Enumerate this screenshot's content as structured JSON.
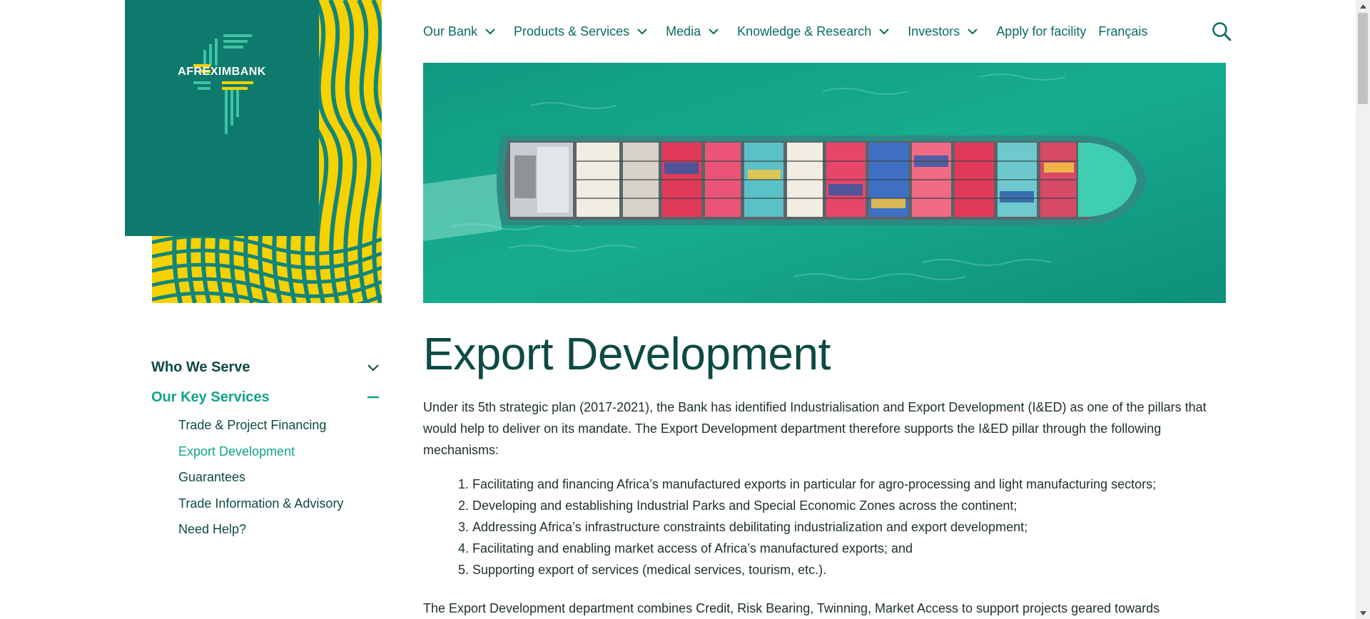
{
  "brand": {
    "name": "AFREXIMBANK"
  },
  "nav": {
    "items": [
      {
        "label": "Our Bank",
        "has_dropdown": true
      },
      {
        "label": "Products & Services",
        "has_dropdown": true
      },
      {
        "label": "Media",
        "has_dropdown": true
      },
      {
        "label": "Knowledge & Research",
        "has_dropdown": true
      },
      {
        "label": "Investors",
        "has_dropdown": true
      },
      {
        "label": "Apply for facility",
        "has_dropdown": false
      },
      {
        "label": "Français",
        "has_dropdown": false
      }
    ],
    "search_icon": "search-icon"
  },
  "sidebar": {
    "groups": [
      {
        "label": "Who We Serve",
        "state": "collapsed"
      },
      {
        "label": "Our Key Services",
        "state": "expanded"
      }
    ],
    "items": [
      {
        "label": "Trade & Project Financing",
        "active": false
      },
      {
        "label": "Export Development",
        "active": true
      },
      {
        "label": "Guarantees",
        "active": false
      },
      {
        "label": "Trade Information & Advisory",
        "active": false
      },
      {
        "label": "Need Help?",
        "active": false
      }
    ]
  },
  "main": {
    "title": "Export Development",
    "intro": "Under its 5th strategic plan (2017-2021), the Bank has identified Industrialisation and Export Development (I&ED) as one of the pillars that would help to deliver on its mandate. The Export Development department therefore supports the I&ED pillar through the following mechanisms:",
    "mechanisms": [
      "Facilitating and financing Africa’s manufactured exports in particular for agro-processing and light manufacturing sectors;",
      "Developing and establishing Industrial Parks and Special Economic Zones across the continent;",
      "Addressing Africa’s infrastructure constraints debilitating industrialization and export development;",
      "Facilitating and enabling market access of Africa’s manufactured exports; and",
      "Supporting export of services (medical services, tourism, etc.)."
    ],
    "after_text": "The Export Development department combines Credit, Risk Bearing, Twinning, Market Access to support projects geared towards promoting"
  },
  "colors": {
    "brand_teal": "#0d7a6d",
    "brand_yellow": "#f6d200",
    "link_teal": "#0b6b61",
    "active_green": "#12a38a",
    "heading_dark": "#0d4a44"
  }
}
